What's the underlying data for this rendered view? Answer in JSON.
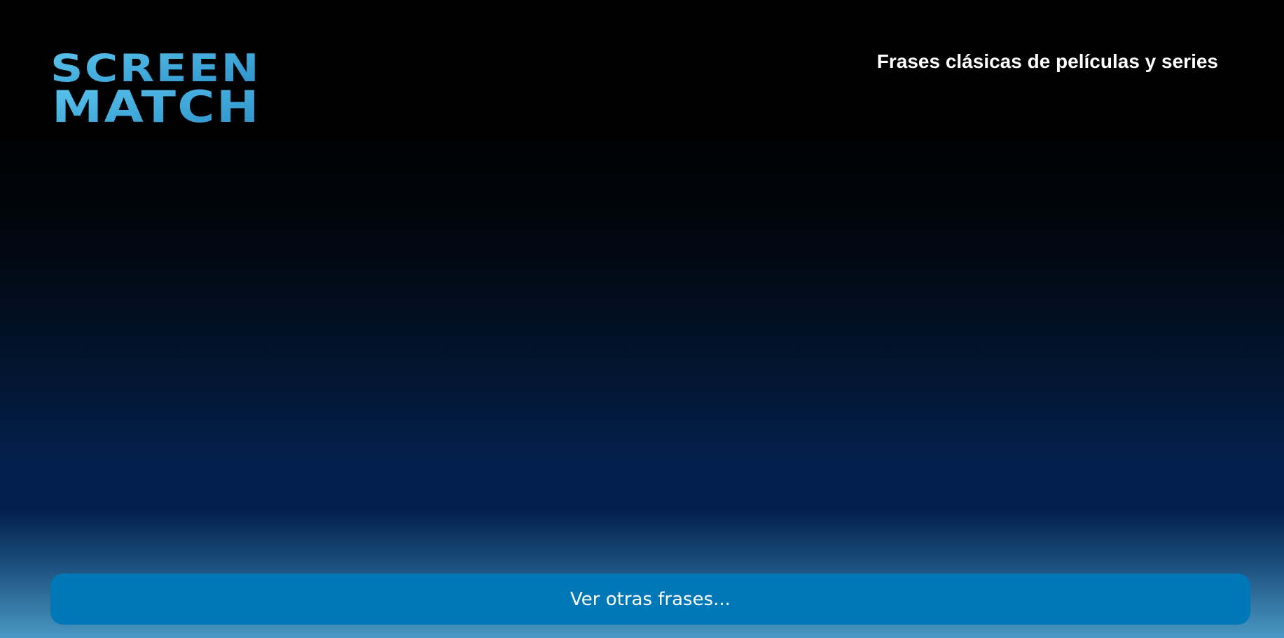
{
  "header": {
    "logo": {
      "line1": "SCREEN",
      "line2": "MATCH",
      "gradient_start": "#2a8fc8",
      "gradient_end": "#5cc6ee"
    },
    "tagline": "Frases clásicas de películas y series"
  },
  "main": {
    "button_label": "Ver otras frases..."
  },
  "colors": {
    "button_bg": "#0077b6",
    "text": "#ffffff",
    "background_top": "#000000",
    "background_mid": "#03204c",
    "background_bottom": "#4a98c4"
  }
}
